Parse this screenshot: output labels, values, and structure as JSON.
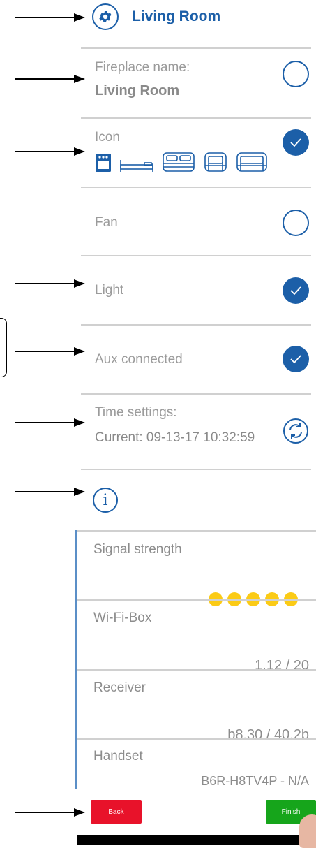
{
  "header": {
    "title": "Living Room",
    "icon": "gear-icon"
  },
  "rows": {
    "name": {
      "label": "Fireplace name:",
      "value": "Living Room",
      "checked": false
    },
    "icon": {
      "label": "Icon",
      "checked": true,
      "icons": [
        "stove-icon",
        "bed-icon",
        "double-bed-icon",
        "armchair-icon",
        "sofa-icon"
      ]
    },
    "fan": {
      "label": "Fan",
      "checked": false
    },
    "light": {
      "label": "Light",
      "checked": true
    },
    "aux": {
      "label": "Aux connected",
      "checked": true
    },
    "time": {
      "label": "Time settings:",
      "current": "Current: 09-13-17 10:32:59",
      "icon": "sync-icon"
    }
  },
  "info": {
    "icon": "info-icon",
    "signal": {
      "label": "Signal strength",
      "level": 5,
      "max": 5
    },
    "wifi": {
      "label": "Wi-Fi-Box",
      "value": "1.12 / 20"
    },
    "receiver": {
      "label": "Receiver",
      "value": "b8.30 / 40.2b"
    },
    "handset": {
      "label": "Handset",
      "value": "B6R-H8TV4P - N/A"
    }
  },
  "footer": {
    "back": "Back",
    "finish": "Finish"
  },
  "colors": {
    "accent": "#1c5fa8",
    "back": "#e8122a",
    "finish": "#16a51b",
    "signal": "#fbcb16"
  }
}
